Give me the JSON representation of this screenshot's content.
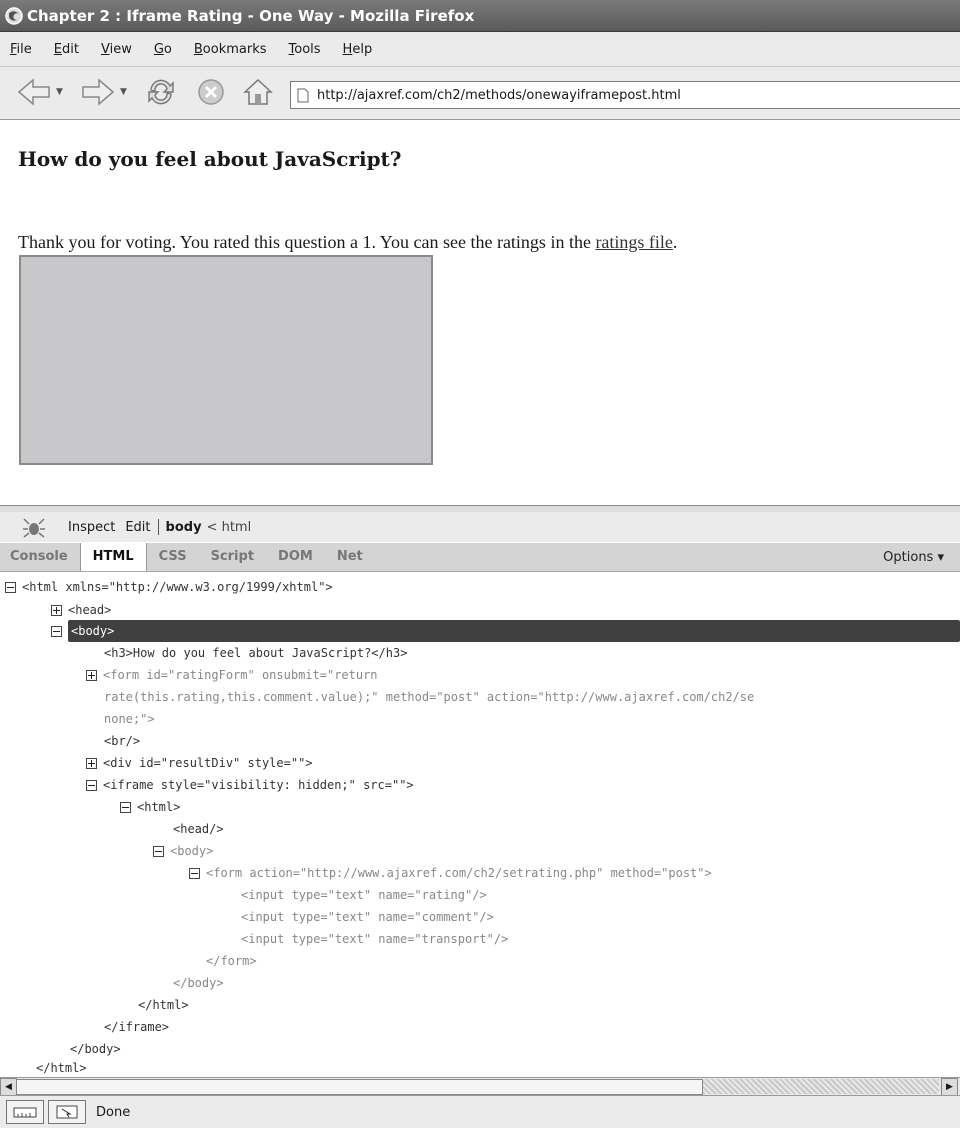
{
  "window": {
    "title": "Chapter 2 : Iframe Rating - One Way - Mozilla Firefox"
  },
  "menu": [
    {
      "label": "File",
      "key": "F",
      "rest": "ile"
    },
    {
      "label": "Edit",
      "key": "E",
      "rest": "dit"
    },
    {
      "label": "View",
      "key": "V",
      "rest": "iew"
    },
    {
      "label": "Go",
      "key": "G",
      "rest": "o"
    },
    {
      "label": "Bookmarks",
      "key": "B",
      "rest": "ookmarks"
    },
    {
      "label": "Tools",
      "key": "T",
      "rest": "ools"
    },
    {
      "label": "Help",
      "key": "H",
      "rest": "elp"
    }
  ],
  "address": {
    "url": "http://ajaxref.com/ch2/methods/onewayiframepost.html"
  },
  "page": {
    "heading": "How do you feel about JavaScript?",
    "message_before": "Thank you for voting. You rated this question a 1. You can see the ratings in the ",
    "link_text": "ratings file",
    "message_after": "."
  },
  "firebug": {
    "toolbar": {
      "inspect": "Inspect",
      "edit": "Edit",
      "crumb_current": "body",
      "crumb_parent": "< html"
    },
    "tabs": [
      "Console",
      "HTML",
      "CSS",
      "Script",
      "DOM",
      "Net"
    ],
    "active_tab": "HTML",
    "options": "Options ▾",
    "tree": [
      {
        "toggle": "minus",
        "text": "<html xmlns=\"http://www.w3.org/1999/xhtml\">"
      },
      {
        "toggle": "plus",
        "text": "<head>"
      },
      {
        "toggle": "minus",
        "text": "<body>",
        "selected": true
      },
      {
        "toggle": "",
        "text": "<h3>How do you feel about JavaScript?</h3>"
      },
      {
        "toggle": "plus",
        "text": "<form id=\"ratingForm\" onsubmit=\"return"
      },
      {
        "toggle": "",
        "text": "rate(this.rating,this.comment.value);\" method=\"post\" action=\"http://www.ajaxref.com/ch2/se"
      },
      {
        "toggle": "",
        "text": "none;\">"
      },
      {
        "toggle": "",
        "text": "<br/>"
      },
      {
        "toggle": "plus",
        "text": "<div id=\"resultDiv\" style=\"\">"
      },
      {
        "toggle": "minus",
        "text": "<iframe style=\"visibility: hidden;\" src=\"\">"
      },
      {
        "toggle": "minus",
        "text": "<html>"
      },
      {
        "toggle": "",
        "text": "<head/>"
      },
      {
        "toggle": "minus",
        "text": "<body>"
      },
      {
        "toggle": "minus",
        "text": "<form action=\"http://www.ajaxref.com/ch2/setrating.php\" method=\"post\">"
      },
      {
        "toggle": "",
        "text": "<input type=\"text\" name=\"rating\"/>"
      },
      {
        "toggle": "",
        "text": "<input type=\"text\" name=\"comment\"/>"
      },
      {
        "toggle": "",
        "text": "<input type=\"text\" name=\"transport\"/>"
      },
      {
        "toggle": "",
        "text": "</form>"
      },
      {
        "toggle": "",
        "text": "</body>"
      },
      {
        "toggle": "",
        "text": "</html>"
      },
      {
        "toggle": "",
        "text": "</iframe>"
      },
      {
        "toggle": "",
        "text": "</body>"
      },
      {
        "toggle": "",
        "text": "</html>"
      }
    ]
  },
  "status": {
    "text": "Done"
  }
}
